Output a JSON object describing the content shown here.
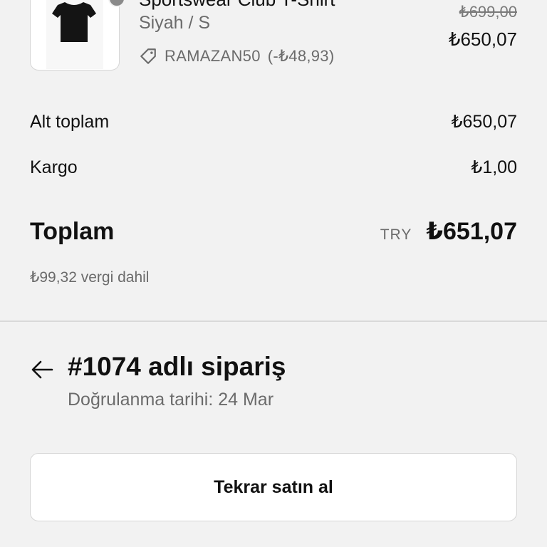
{
  "product": {
    "title": "Sportswear Club T-Shirt",
    "variant": "Siyah / S",
    "discount_code": "RAMAZAN50",
    "discount_amount": "(-₺48,93)",
    "price_original": "₺699,00",
    "price_final": "₺650,07",
    "icon": "tag-icon"
  },
  "summary": {
    "subtotal_label": "Alt toplam",
    "subtotal_value": "₺650,07",
    "shipping_label": "Kargo",
    "shipping_value": "₺1,00",
    "total_label": "Toplam",
    "total_currency": "TRY",
    "total_value": "₺651,07",
    "tax_note": "₺99,32 vergi dahil"
  },
  "order": {
    "title": "#1074 adlı sipariş",
    "confirmation": "Doğrulanma tarihi: 24 Mar",
    "back_icon": "arrow-left-icon"
  },
  "actions": {
    "rebuy_label": "Tekrar satın al"
  },
  "colors": {
    "background": "#f2f2f2",
    "card": "#ffffff",
    "text_primary": "#111111",
    "text_secondary": "#6b6b6b",
    "divider": "#d9d9d9"
  }
}
